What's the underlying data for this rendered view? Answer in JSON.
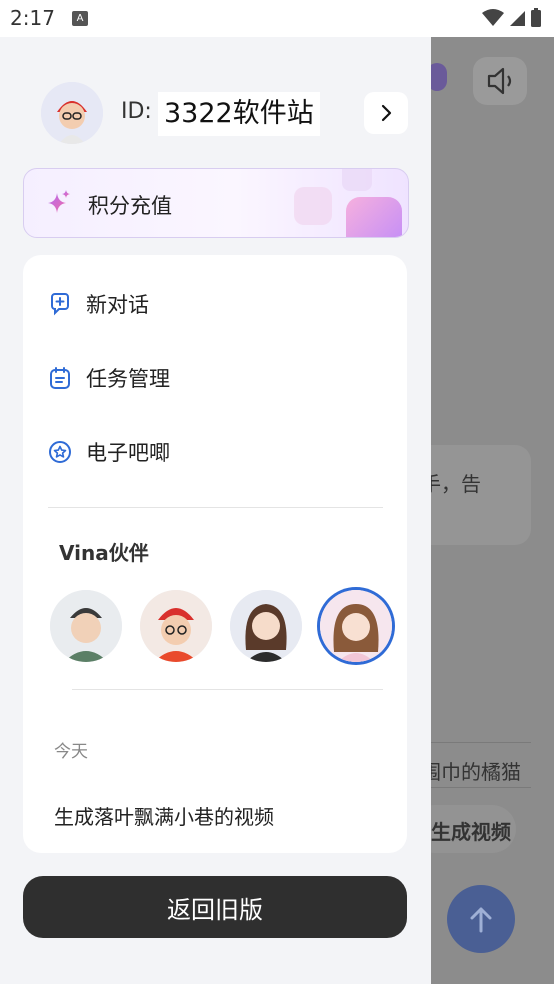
{
  "status_bar": {
    "time": "2:17",
    "notification_icon": "A"
  },
  "profile": {
    "id_label": "ID:",
    "id_value": "3322软件站"
  },
  "points_banner": {
    "label": "积分充值"
  },
  "menu": [
    {
      "label": "新对话",
      "icon": "chat-plus-icon"
    },
    {
      "label": "任务管理",
      "icon": "task-icon"
    },
    {
      "label": "电子吧唧",
      "icon": "badge-star-icon"
    }
  ],
  "companions": {
    "title": "Vina伙伴",
    "items": [
      {
        "name": "companion-1"
      },
      {
        "name": "companion-2"
      },
      {
        "name": "companion-3"
      },
      {
        "name": "companion-4",
        "selected": true
      }
    ]
  },
  "history": {
    "group_label": "今天",
    "items": [
      "生成落叶飘满小巷的视频"
    ]
  },
  "old_version_button": "返回旧版",
  "background_app": {
    "bubble_text": "手，告",
    "prompt_text": "围巾的橘猫",
    "generate_button": "生成视频"
  },
  "colors": {
    "accent": "#2f6bd6",
    "button_dark": "#2f2f2f",
    "drawer_bg": "#f3f4f7"
  }
}
